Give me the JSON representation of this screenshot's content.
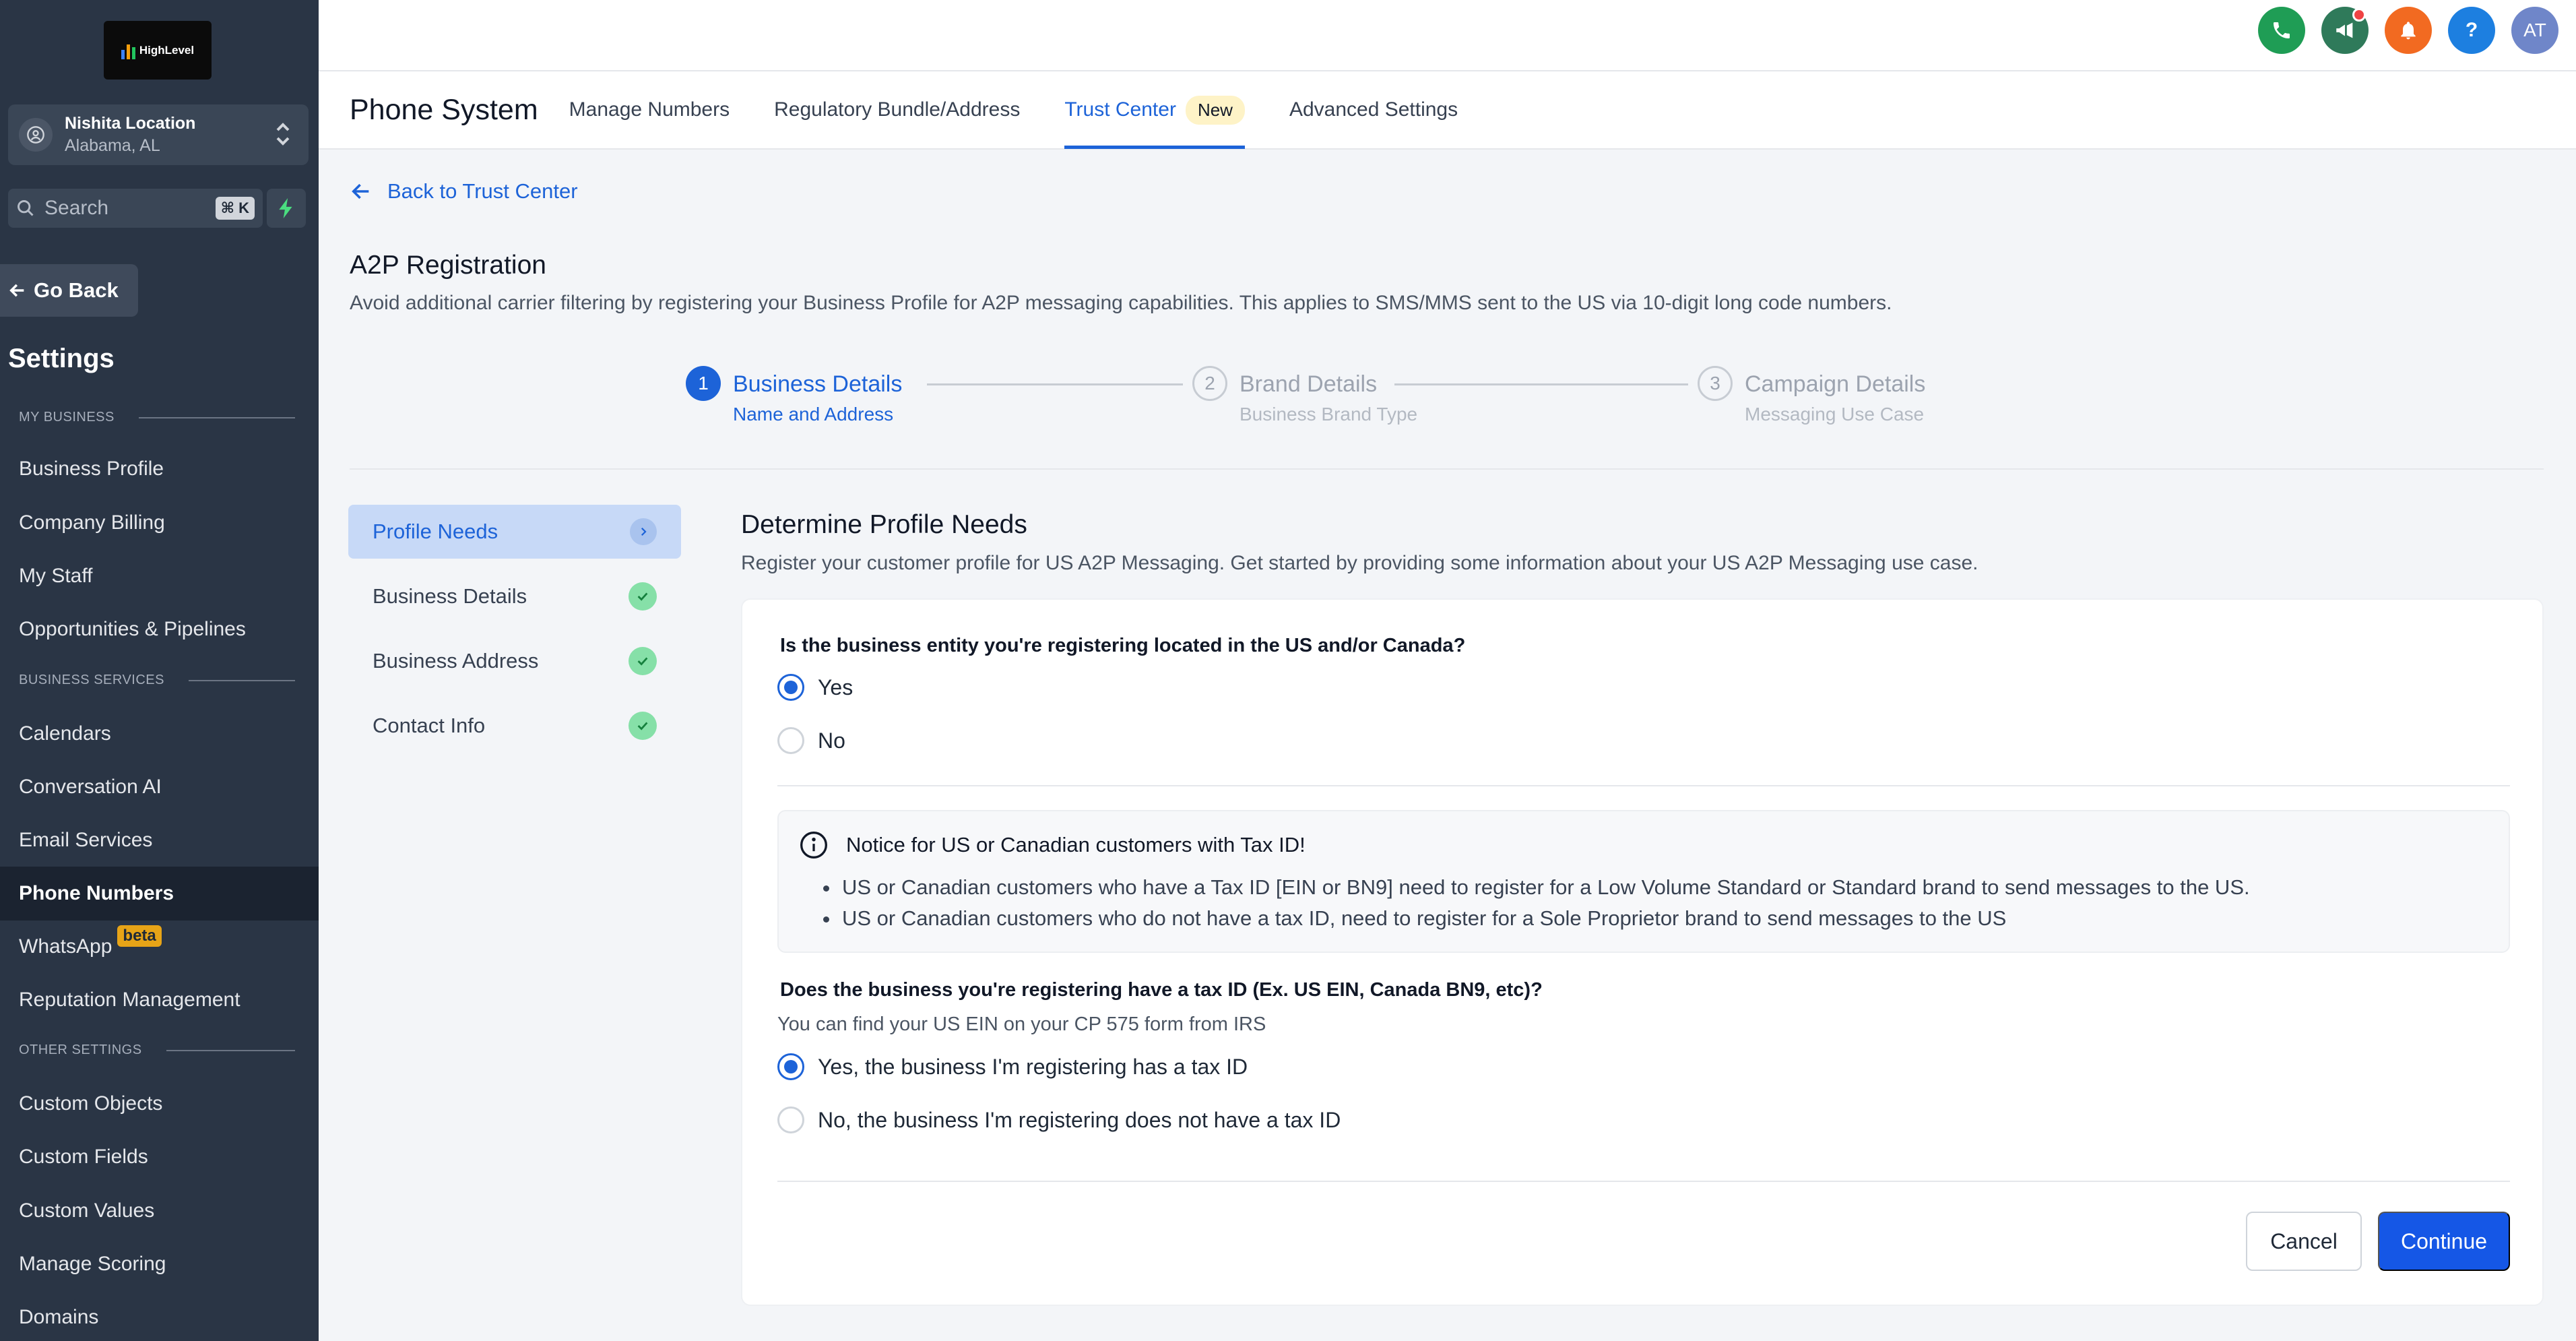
{
  "sidebar": {
    "logo_text": "HighLevel",
    "location": {
      "name": "Nishita Location",
      "sub": "Alabama, AL"
    },
    "search": {
      "placeholder": "Search",
      "shortcut": "⌘ K"
    },
    "go_back": "Go Back",
    "title": "Settings",
    "sections": {
      "my_business": "MY BUSINESS",
      "business_services": "BUSINESS SERVICES",
      "other_settings": "OTHER SETTINGS"
    },
    "items": [
      "Business Profile",
      "Company Billing",
      "My Staff",
      "Opportunities & Pipelines",
      "Calendars",
      "Conversation AI",
      "Email Services",
      "Phone Numbers",
      "WhatsApp",
      "Reputation Management",
      "Custom Objects",
      "Custom Fields",
      "Custom Values",
      "Manage Scoring",
      "Domains"
    ],
    "whatsapp_badge": "beta",
    "active_item": "Phone Numbers"
  },
  "topbar": {
    "avatar_initials": "AT",
    "help_symbol": "?",
    "icons": [
      "phone-icon",
      "megaphone-icon",
      "bell-icon",
      "help-icon"
    ],
    "colors": {
      "phone": "#1f9d55",
      "megaphone": "#2f7a5a",
      "bell": "#f26a21",
      "help": "#1d7fe0",
      "avatar": "#6f86c9"
    }
  },
  "tabs": {
    "title": "Phone System",
    "items": [
      "Manage Numbers",
      "Regulatory Bundle/Address",
      "Trust Center",
      "Advanced Settings"
    ],
    "active": "Trust Center",
    "new_badge": "New"
  },
  "content": {
    "back_link": "Back to Trust Center",
    "title": "A2P Registration",
    "description": "Avoid additional carrier filtering by registering your Business Profile for A2P messaging capabilities. This applies to SMS/MMS sent to the US via 10-digit long code numbers."
  },
  "stepper": [
    {
      "num": "1",
      "title": "Business Details",
      "sub": "Name and Address",
      "state": "active"
    },
    {
      "num": "2",
      "title": "Brand Details",
      "sub": "Business Brand Type",
      "state": "pending"
    },
    {
      "num": "3",
      "title": "Campaign Details",
      "sub": "Messaging Use Case",
      "state": "pending"
    }
  ],
  "side_steps": [
    {
      "label": "Profile Needs",
      "state": "active"
    },
    {
      "label": "Business Details",
      "state": "done"
    },
    {
      "label": "Business Address",
      "state": "done"
    },
    {
      "label": "Contact Info",
      "state": "done"
    }
  ],
  "form": {
    "title": "Determine Profile Needs",
    "description": "Register your customer profile for US A2P Messaging. Get started by providing some information about your US A2P Messaging use case.",
    "q1": {
      "label": "Is the business entity you're registering located in the US and/or Canada?",
      "options": [
        "Yes",
        "No"
      ],
      "selected": "Yes"
    },
    "notice": {
      "title": "Notice for US or Canadian customers with Tax ID!",
      "items": [
        "US or Canadian customers who have a Tax ID [EIN or BN9] need to register for a Low Volume Standard or Standard brand to send messages to the US.",
        "US or Canadian customers who do not have a tax ID, need to register for a Sole Proprietor brand to send messages to the US"
      ]
    },
    "q2": {
      "label": "Does the business you're registering have a tax ID (Ex. US EIN, Canada BN9, etc)?",
      "hint": "You can find your US EIN on your CP 575 form from IRS",
      "options": [
        "Yes, the business I'm registering has a tax ID",
        "No, the business I'm registering does not have a tax ID"
      ],
      "selected": "Yes, the business I'm registering has a tax ID"
    },
    "cancel": "Cancel",
    "continue": "Continue"
  },
  "colors": {
    "accent": "#1d63d8",
    "sidebar_bg": "#2a3545",
    "success": "#86e0a8",
    "primary_button": "#1557e6"
  }
}
